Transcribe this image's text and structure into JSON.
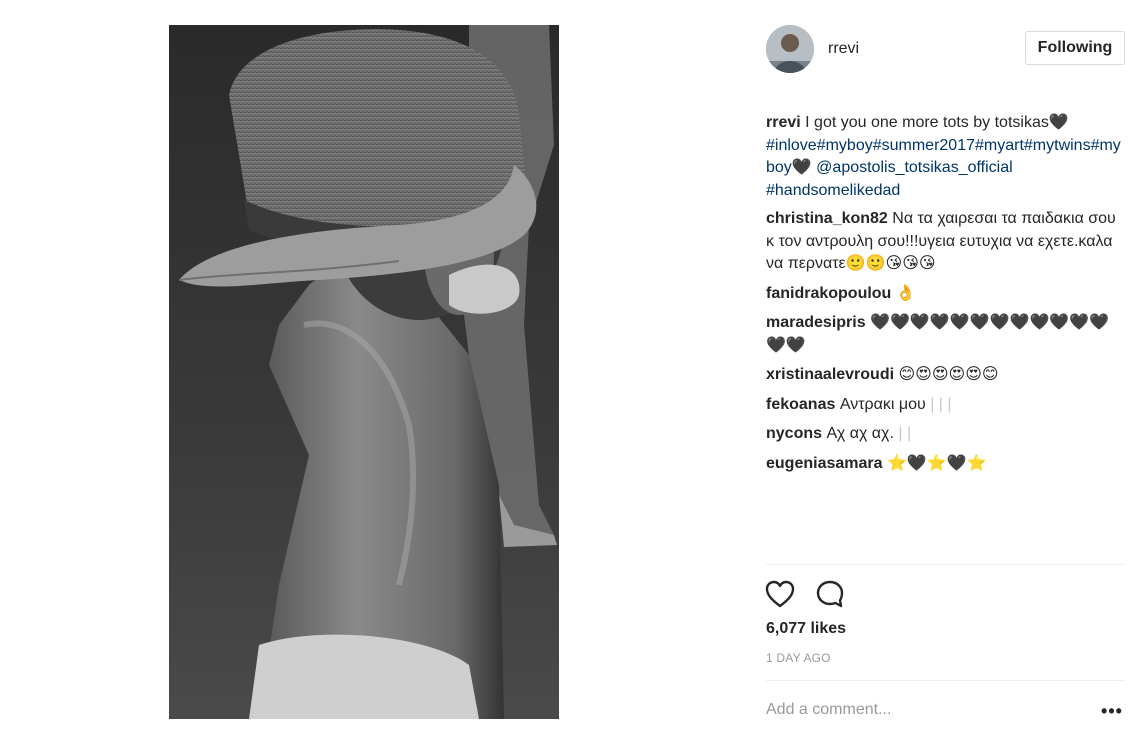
{
  "post": {
    "photo_alt": "Black and white photo of a boy in a straw hat"
  },
  "owner": {
    "username": "rrevi",
    "follow_label": "Following"
  },
  "caption": {
    "user": "rrevi",
    "text": "I got you one more tots by totsikas🖤",
    "tags_line": "#inlove#myboy#summer2017#myart#mytwins#myboy",
    "heart": "🖤",
    "mention": "@apostolis_totsikas_official",
    "last_tag": "#handsomelikedad"
  },
  "comments": [
    {
      "user": "christina_kon82",
      "text": "Να τα χαιρεσαι τα παιδακια σου κ τον αντρουλη σου!!!υγεια ευτυχια να εχετε.καλα να περνατε🙂🙂😘😘😘",
      "ghost": ""
    },
    {
      "user": "fanidrakopoulou",
      "text": "👌",
      "ghost": ""
    },
    {
      "user": "maradesipris",
      "text": "🖤🖤🖤🖤🖤🖤🖤🖤🖤🖤🖤🖤🖤🖤",
      "ghost": ""
    },
    {
      "user": "xristinaalevroudi",
      "text": "😊😍😍😍😍😊",
      "ghost": ""
    },
    {
      "user": "fekoanas",
      "text": "Αντρακι μου",
      "ghost": "| | |"
    },
    {
      "user": "nycons",
      "text": "Αχ αχ αχ.",
      "ghost": "| |"
    },
    {
      "user": "eugeniasamara",
      "text": "⭐🖤⭐🖤⭐",
      "ghost": ""
    }
  ],
  "actions": {
    "like_icon": "heart-outline-icon",
    "comment_icon": "speech-bubble-icon"
  },
  "likes_label": "6,077 likes",
  "date_label": "1 DAY AGO",
  "comment_box": {
    "placeholder": "Add a comment...",
    "more_icon": "ellipsis-icon",
    "more_label": "•••"
  }
}
